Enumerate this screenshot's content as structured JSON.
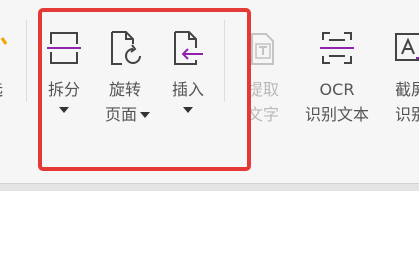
{
  "toolbar": {
    "left_partial_label": "选",
    "split": {
      "label": "拆分",
      "icon": "split-icon"
    },
    "rotate": {
      "label_line1": "旋转",
      "label_line2": "页面",
      "icon": "rotate-page-icon"
    },
    "insert": {
      "label": "插入",
      "icon": "insert-page-icon"
    },
    "extract": {
      "label_line1": "提取",
      "label_line2": "文字",
      "icon": "extract-text-icon"
    },
    "ocr": {
      "label_line1": "OCR",
      "label_line2": "识别文本",
      "icon": "ocr-scan-icon"
    },
    "screenshot": {
      "label_line1": "截屏",
      "label_line2": "识别",
      "icon": "screenshot-ocr-icon"
    }
  },
  "colors": {
    "highlight": "#e53935",
    "accent_purple": "#8e24aa",
    "icon_dark": "#444444",
    "disabled": "#b9b9b9"
  }
}
